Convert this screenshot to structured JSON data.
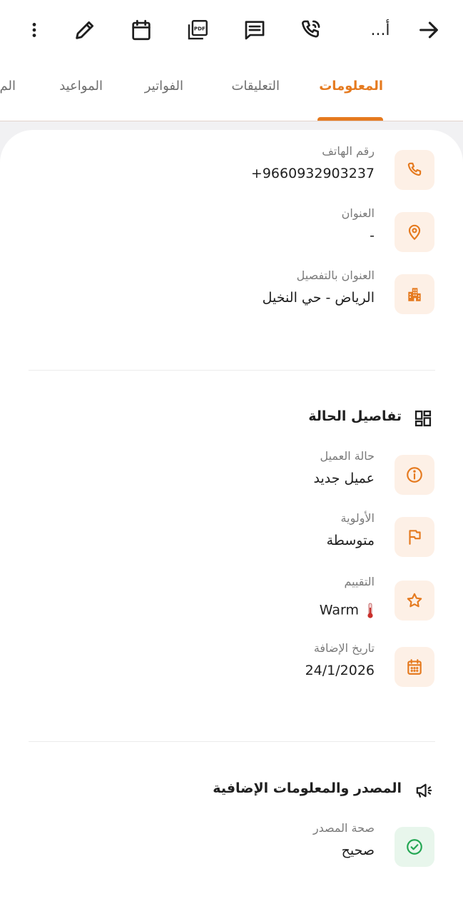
{
  "toolbar": {
    "title": "أ...",
    "icons": [
      "arrow-forward-icon",
      "phone-call-icon",
      "chat-icon",
      "pdf-icon",
      "calendar-icon",
      "edit-icon",
      "more-vertical-icon"
    ]
  },
  "tabs": {
    "items": [
      "المعلومات",
      "التعليقات",
      "الفواتير",
      "المواعيد",
      "الم"
    ],
    "active_index": 0
  },
  "contact": {
    "phone": {
      "label": "رقم الهاتف",
      "value": "9660932903237+"
    },
    "address": {
      "label": "العنوان",
      "value": "-"
    },
    "address_detail": {
      "label": "العنوان بالتفصيل",
      "value": "الرياض - حي النخيل"
    }
  },
  "status_section": {
    "title": "تفاصيل الحالة",
    "customer_status": {
      "label": "حالة العميل",
      "value": "عميل جديد"
    },
    "priority": {
      "label": "الأولوية",
      "value": "متوسطة"
    },
    "rating": {
      "label": "التقييم",
      "value": "Warm"
    },
    "added_date": {
      "label": "تاريخ الإضافة",
      "value": "24/1/2026"
    }
  },
  "source_section": {
    "title": "المصدر والمعلومات الإضافية",
    "source_validity": {
      "label": "صحة المصدر",
      "value": "صحيح"
    }
  },
  "colors": {
    "accent": "#e57a1f",
    "icon_bg": "#fdf0e6",
    "success": "#22a652",
    "success_bg": "#e8f6ec"
  }
}
